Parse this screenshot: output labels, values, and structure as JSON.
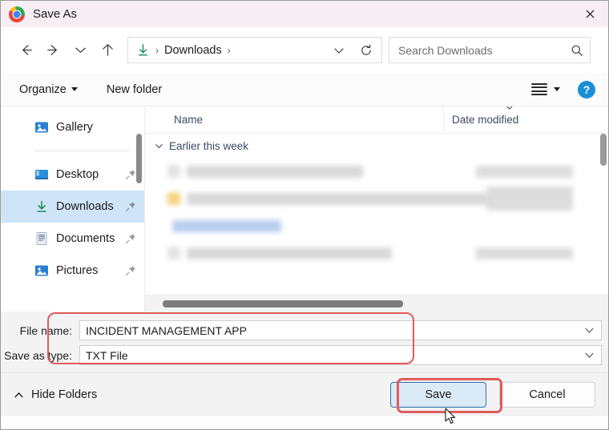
{
  "window": {
    "title": "Save As",
    "app_icon": "chrome-logo-icon",
    "close_label": "×"
  },
  "nav": {
    "back": "back-arrow-icon",
    "forward": "forward-arrow-icon",
    "recent": "chevron-down-icon",
    "up": "up-arrow-icon",
    "address": {
      "location_icon": "downloads-arrow-icon",
      "crumb": "Downloads",
      "sep1": "›",
      "sep2": "›",
      "dropdown_icon": "chevron-down-icon",
      "refresh_icon": "refresh-icon"
    },
    "search": {
      "placeholder": "Search Downloads",
      "value": "",
      "icon": "search-icon"
    }
  },
  "commandbar": {
    "organize": "Organize",
    "new_folder": "New folder",
    "view_icon": "list-view-icon",
    "view_caret": "caret-down-icon",
    "help": "?"
  },
  "sidebar": {
    "items": [
      {
        "label": "Gallery",
        "icon": "gallery-icon",
        "pinned": false,
        "selected": false
      },
      {
        "label": "Desktop",
        "icon": "desktop-icon",
        "pinned": true,
        "selected": false
      },
      {
        "label": "Downloads",
        "icon": "downloads-icon",
        "pinned": true,
        "selected": true
      },
      {
        "label": "Documents",
        "icon": "documents-icon",
        "pinned": true,
        "selected": false
      },
      {
        "label": "Pictures",
        "icon": "pictures-icon",
        "pinned": true,
        "selected": false
      }
    ]
  },
  "filelist": {
    "columns": {
      "name": "Name",
      "date_modified": "Date modified"
    },
    "group": {
      "label": "Earlier this week",
      "chevron": "chevron-down-icon"
    },
    "rows": [
      {
        "name": "██████ ███ ████ ███ █ ████",
        "date": "██ ██ ████ ████",
        "icon": "document-icon"
      },
      {
        "name": "███████ ████ ████ ███ █ ████ █████ █████ ███",
        "date": "██ ██ ████ ████",
        "icon": "folder-icon"
      },
      {
        "name": "██ ████ ████ ███",
        "date": "",
        "icon": "link-icon"
      },
      {
        "name": "███████ ███████████ ████████",
        "date": "██ ██ ████ ████",
        "icon": "document-icon"
      }
    ]
  },
  "form": {
    "file_name_label": "File name:",
    "file_name_value": "INCIDENT MANAGEMENT APP",
    "save_as_type_label": "Save as type:",
    "save_as_type_value": "TXT File",
    "dropdown_icon": "chevron-down-icon"
  },
  "footer": {
    "hide_folders": "Hide Folders",
    "hide_folders_icon": "chevron-up-icon",
    "save": "Save",
    "cancel": "Cancel"
  },
  "annotations": {
    "highlight_color": "#e05b5b",
    "fields_box": "red-highlight-fields",
    "save_box": "red-highlight-save-button"
  },
  "colors": {
    "titlebar": "#f7eef4",
    "selection": "#cfe5f7",
    "accent_blue": "#1a8fd8",
    "primary_button_border": "#2f6fa8",
    "downloads_green": "#1e8e5a"
  }
}
